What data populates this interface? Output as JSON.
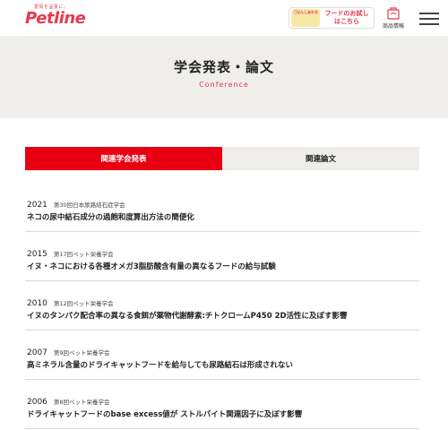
{
  "header": {
    "logo_tagline": "愛情を品質に。",
    "logo_text": "Petline",
    "promo_badge_text": "ごはんしあわせ",
    "promo_label_line1": "フードのお試し",
    "promo_label_line2": "はこちら",
    "products_label": "商品情報",
    "products_icon": "products-box-icon",
    "menu_icon": "hamburger-icon"
  },
  "hero": {
    "title": "学会発表・論文",
    "subtitle": "Conference"
  },
  "tabs": [
    {
      "label": "関連学会発表",
      "active": true
    },
    {
      "label": "関連論文",
      "active": false
    }
  ],
  "items": [
    {
      "year": "2021",
      "society": "第30回日本尿路結石症学会",
      "title": "ネコの尿中結石成分の過飽和度算出方法の簡便化"
    },
    {
      "year": "2015",
      "society": "第17回ペット栄養学会",
      "title": "イヌ・ネコにおける各種オメガ3脂肪酸含有量の異なるフードの給与試験"
    },
    {
      "year": "2010",
      "society": "第12回ペット栄養学会",
      "title": "イヌのタンパク配合率の異なる食餌が薬物代謝酵素:チトクロームP450 2D活性に及ぼす影響"
    },
    {
      "year": "2007",
      "society": "第9回ペット栄養学会",
      "title": "高ミネラル含量のドライキャットフードを給与しても尿路結石は形成されない"
    },
    {
      "year": "2006",
      "society": "第8回ペット栄養学会",
      "title": "ドライキャットフードのbase excess値が ストルバイト関連因子に及ぼす影響"
    }
  ],
  "colors": {
    "brand": "#e8374f",
    "tab_active": "#e60012",
    "hero_bg": "#efeeeb",
    "tab_inactive_bg": "#eeedea",
    "divider": "#d9d9d9"
  }
}
